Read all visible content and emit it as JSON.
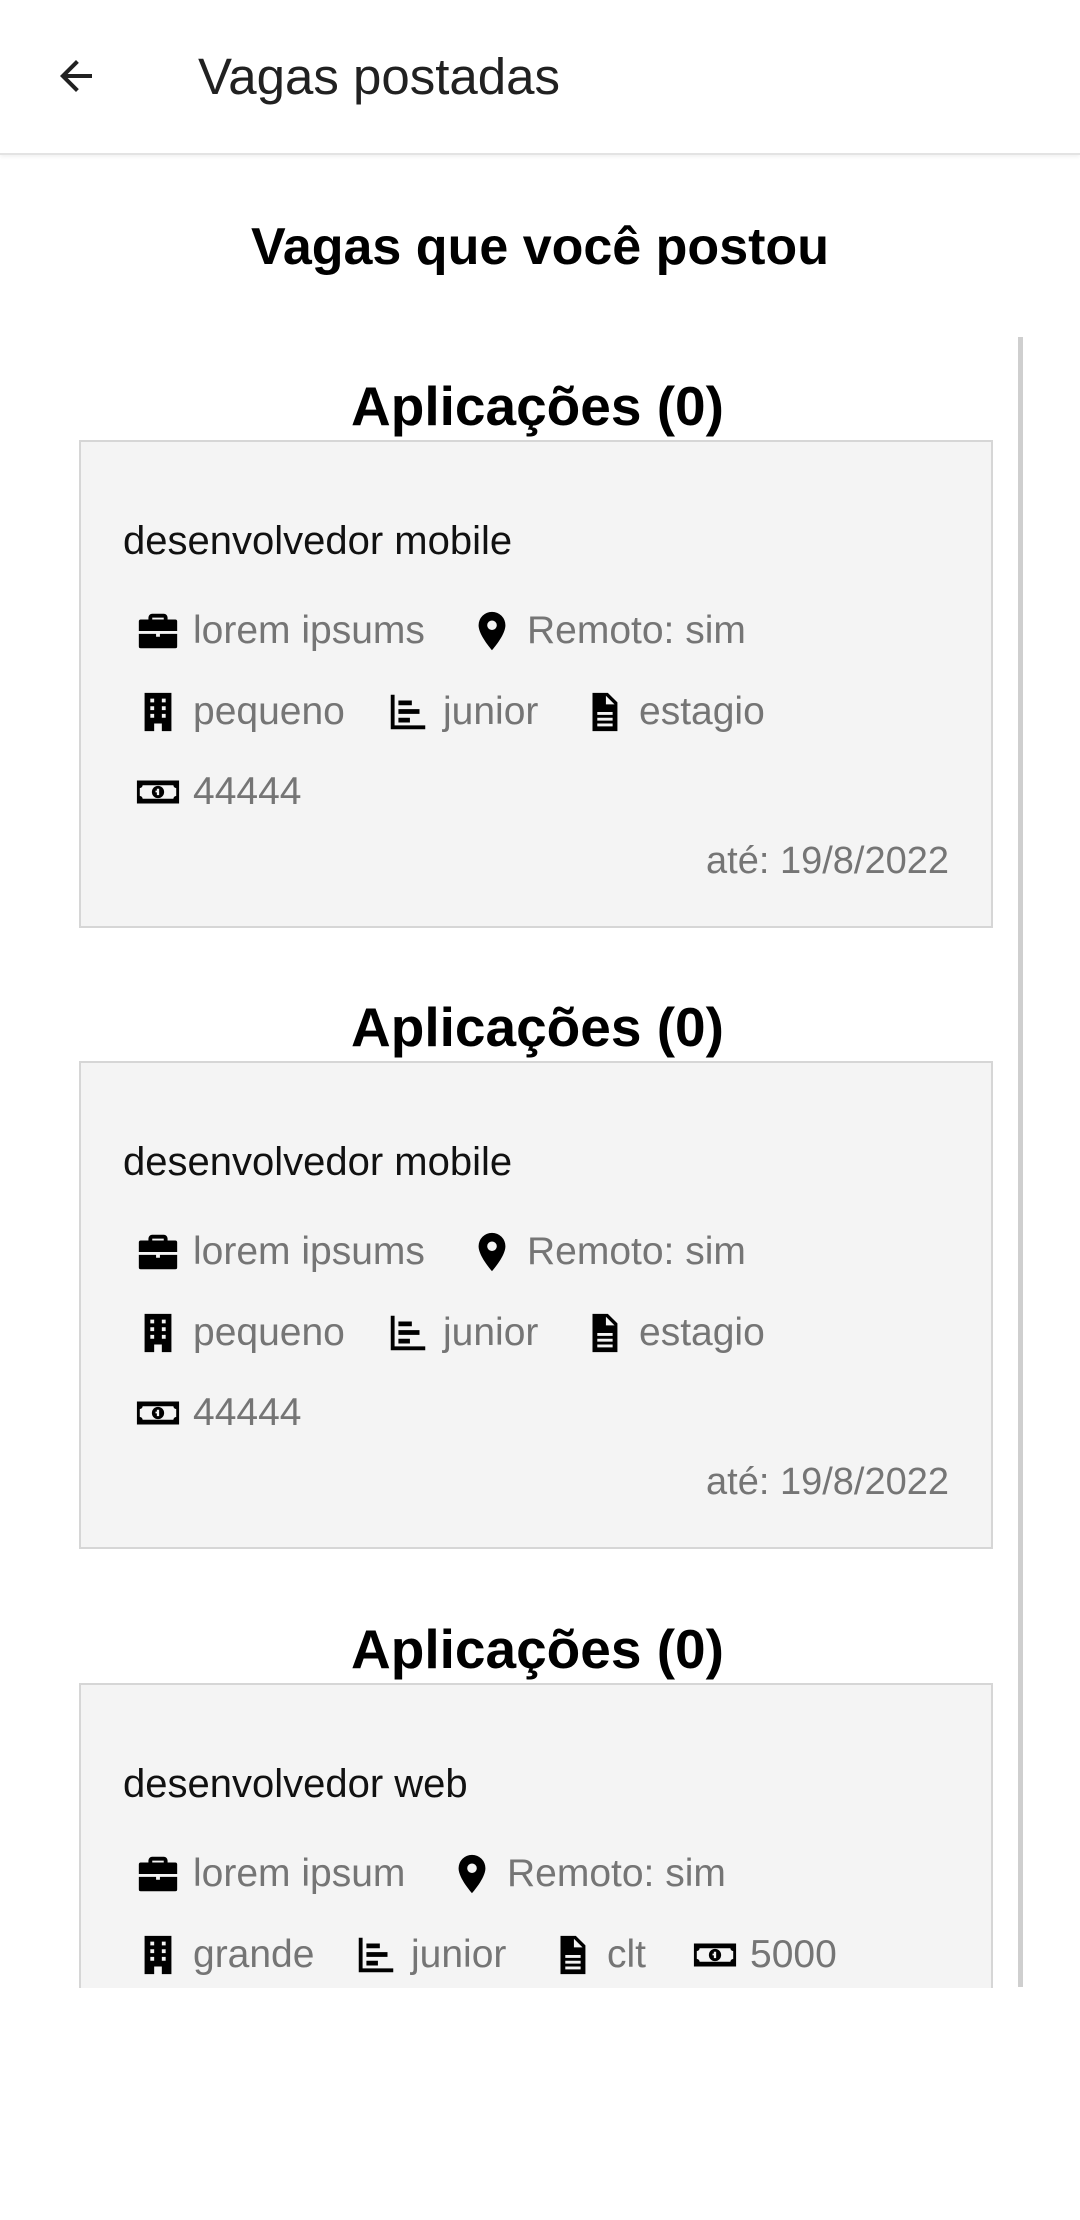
{
  "appbar": {
    "title": "Vagas postadas",
    "back_icon": "arrow-left-icon"
  },
  "heading": "Vagas que você postou",
  "jobs": [
    {
      "applications": "Aplicações (0)",
      "title": "desenvolvedor mobile",
      "company": "lorem ipsums",
      "remote": "Remoto: sim",
      "size": "pequeno",
      "level": "junior",
      "contract": "estagio",
      "salary": "44444",
      "deadline": "até: 19/8/2022"
    },
    {
      "applications": "Aplicações (0)",
      "title": "desenvolvedor mobile",
      "company": "lorem ipsums",
      "remote": "Remoto: sim",
      "size": "pequeno",
      "level": "junior",
      "contract": "estagio",
      "salary": "44444",
      "deadline": "até: 19/8/2022"
    },
    {
      "applications": "Aplicações (0)",
      "title": "desenvolvedor web",
      "company": "lorem ipsum",
      "remote": "Remoto: sim",
      "size": "grande",
      "level": "junior",
      "contract": "clt",
      "salary": "5000"
    }
  ],
  "icons": {
    "company": "briefcase-icon",
    "remote": "map-pin-icon",
    "size": "building-icon",
    "level": "bar-chart-icon",
    "contract": "document-icon",
    "salary": "money-bill-icon"
  },
  "colors": {
    "card_bg": "#f4f4f4",
    "muted_text": "#757575"
  }
}
